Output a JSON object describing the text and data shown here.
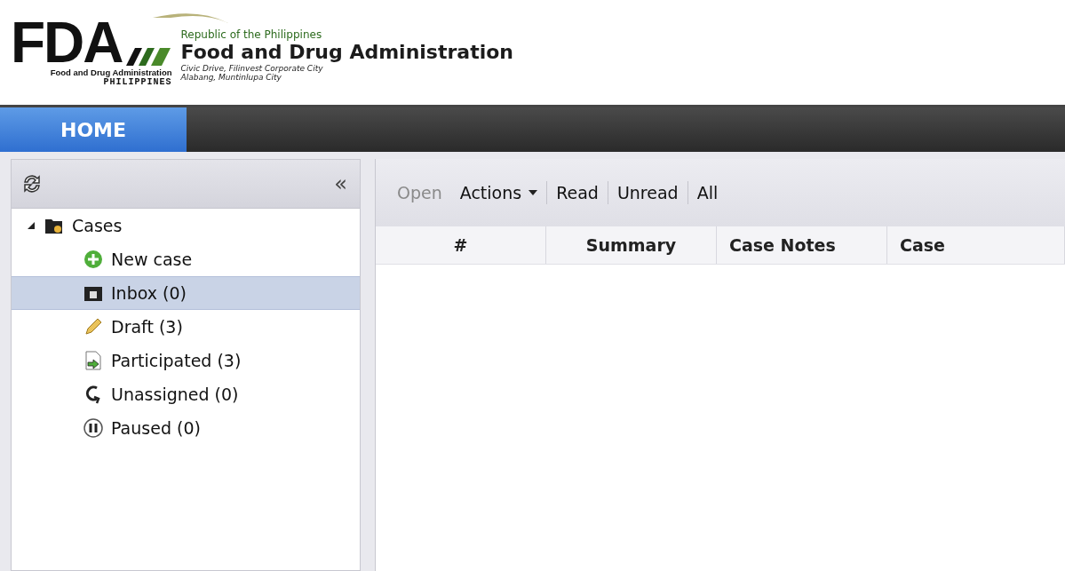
{
  "header": {
    "logo_text": "FDA",
    "logo_caption": "Food and Drug Administration",
    "logo_country": "PHILIPPINES",
    "republic": "Republic of the Philippines",
    "agency": "Food and Drug Administration",
    "address_lines": [
      "Civic Drive, Filinvest Corporate City",
      "Alabang, Muntinlupa City"
    ]
  },
  "nav": {
    "tabs": [
      {
        "label": "HOME",
        "selected": true
      }
    ]
  },
  "sidebar": {
    "collapse_glyph": "«",
    "tree": [
      {
        "label": "Cases",
        "kind": "folder",
        "expanded": true,
        "selected": false,
        "children": [
          {
            "label": "New case",
            "kind": "new",
            "selected": false
          },
          {
            "label": "Inbox (0)",
            "kind": "inbox",
            "selected": true
          },
          {
            "label": "Draft (3)",
            "kind": "draft",
            "selected": false
          },
          {
            "label": "Participated (3)",
            "kind": "participated",
            "selected": false
          },
          {
            "label": "Unassigned (0)",
            "kind": "unassigned",
            "selected": false
          },
          {
            "label": "Paused (0)",
            "kind": "paused",
            "selected": false
          }
        ]
      }
    ]
  },
  "toolbar": {
    "items": [
      {
        "label": "Open",
        "disabled": true,
        "dropdown": false
      },
      {
        "label": "Actions",
        "disabled": false,
        "dropdown": true
      },
      {
        "label": "Read",
        "disabled": false,
        "dropdown": false
      },
      {
        "label": "Unread",
        "disabled": false,
        "dropdown": false
      },
      {
        "label": "All",
        "disabled": false,
        "dropdown": false
      }
    ]
  },
  "table": {
    "columns": [
      "#",
      "Summary",
      "Case Notes",
      "Case"
    ]
  }
}
